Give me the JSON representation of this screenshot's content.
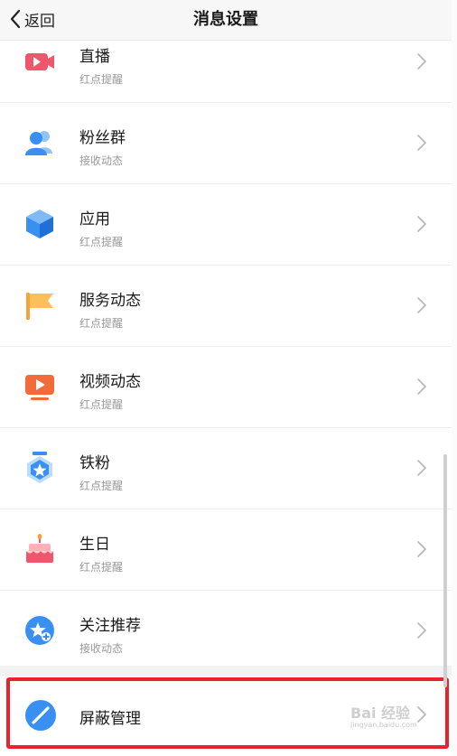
{
  "header": {
    "back_label": "返回",
    "title": "消息设置"
  },
  "items": [
    {
      "label": "直播",
      "sub": "红点提醒",
      "icon": "live-video-icon"
    },
    {
      "label": "粉丝群",
      "sub": "接收动态",
      "icon": "fan-group-icon"
    },
    {
      "label": "应用",
      "sub": "红点提醒",
      "icon": "app-cube-icon"
    },
    {
      "label": "服务动态",
      "sub": "红点提醒",
      "icon": "flag-icon"
    },
    {
      "label": "视频动态",
      "sub": "红点提醒",
      "icon": "video-play-icon"
    },
    {
      "label": "铁粉",
      "sub": "红点提醒",
      "icon": "badge-star-icon"
    },
    {
      "label": "生日",
      "sub": "红点提醒",
      "icon": "birthday-cake-icon"
    },
    {
      "label": "关注推荐",
      "sub": "接收动态",
      "icon": "star-circle-icon"
    }
  ],
  "block": {
    "label": "屏蔽管理",
    "icon": "block-icon"
  },
  "watermark": {
    "main": "Bai 经验",
    "url": "jingyan.baidu.com"
  },
  "colors": {
    "highlight": "#e8232b",
    "live": "#f0566b",
    "blue": "#3a8ff3",
    "orange": "#f7a23c"
  }
}
